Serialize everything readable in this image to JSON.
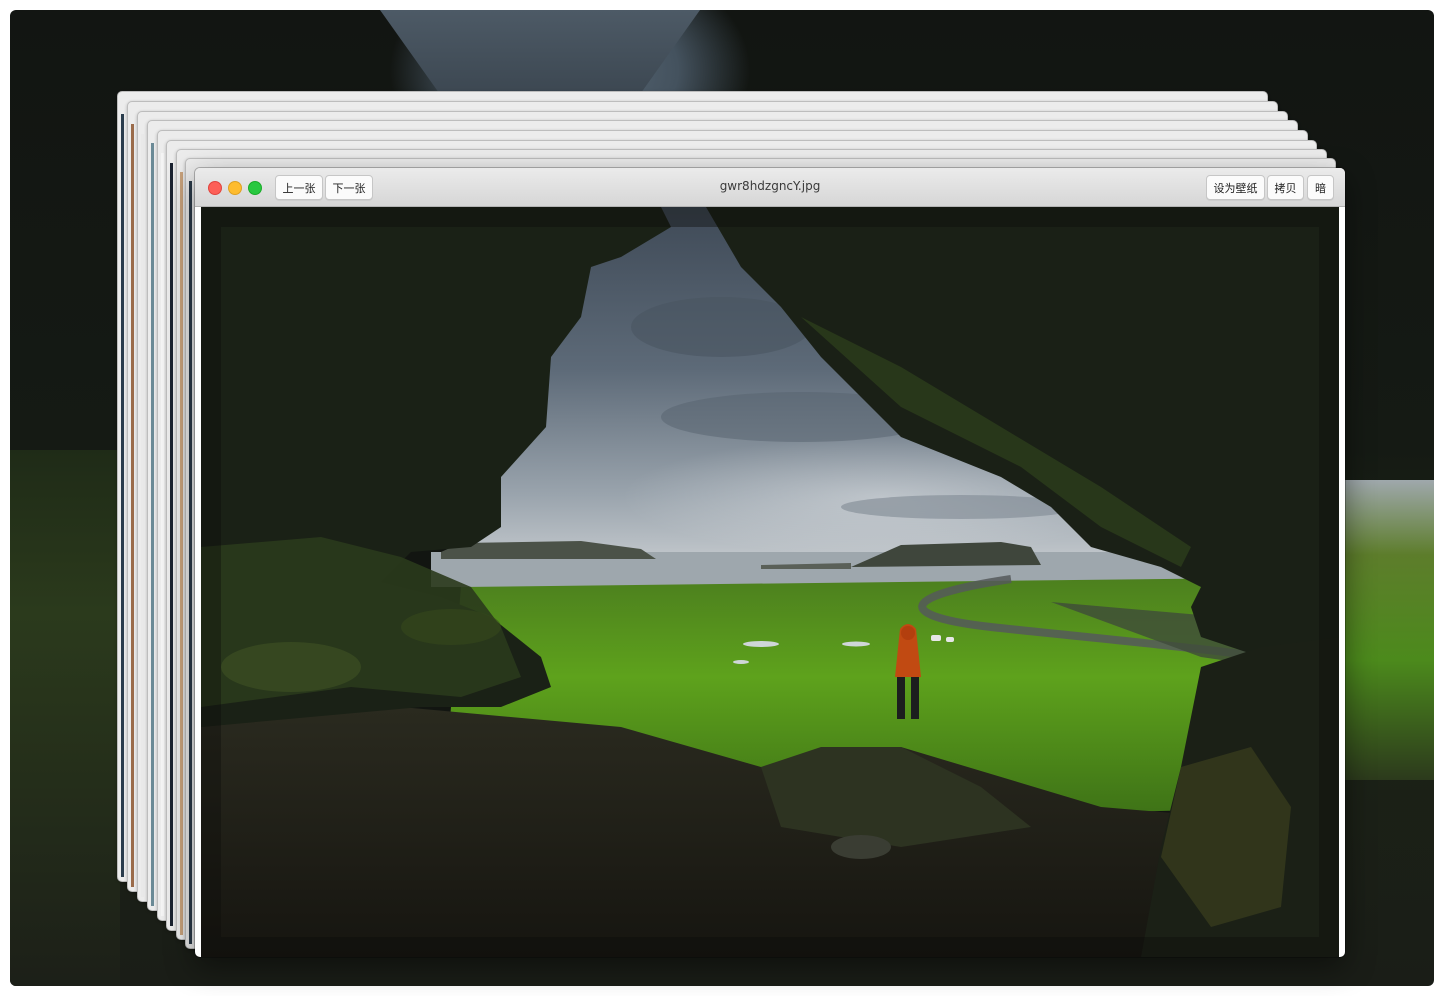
{
  "window": {
    "title": "gwr8hdzgncY.jpg",
    "traffic_lights": {
      "close": "close-light",
      "minimize": "minimize-light",
      "zoom": "zoom-light"
    }
  },
  "toolbar": {
    "prev_label": "上一张",
    "next_label": "下一张",
    "set_wallpaper_label": "设为壁纸",
    "copy_label": "拷贝",
    "dark_label": "暗"
  },
  "colors": {
    "close": "#fd5f57",
    "minimize": "#febc2e",
    "zoom": "#28c840",
    "titlebar": "#e2e2e2"
  },
  "stacked_windows_count": 8
}
